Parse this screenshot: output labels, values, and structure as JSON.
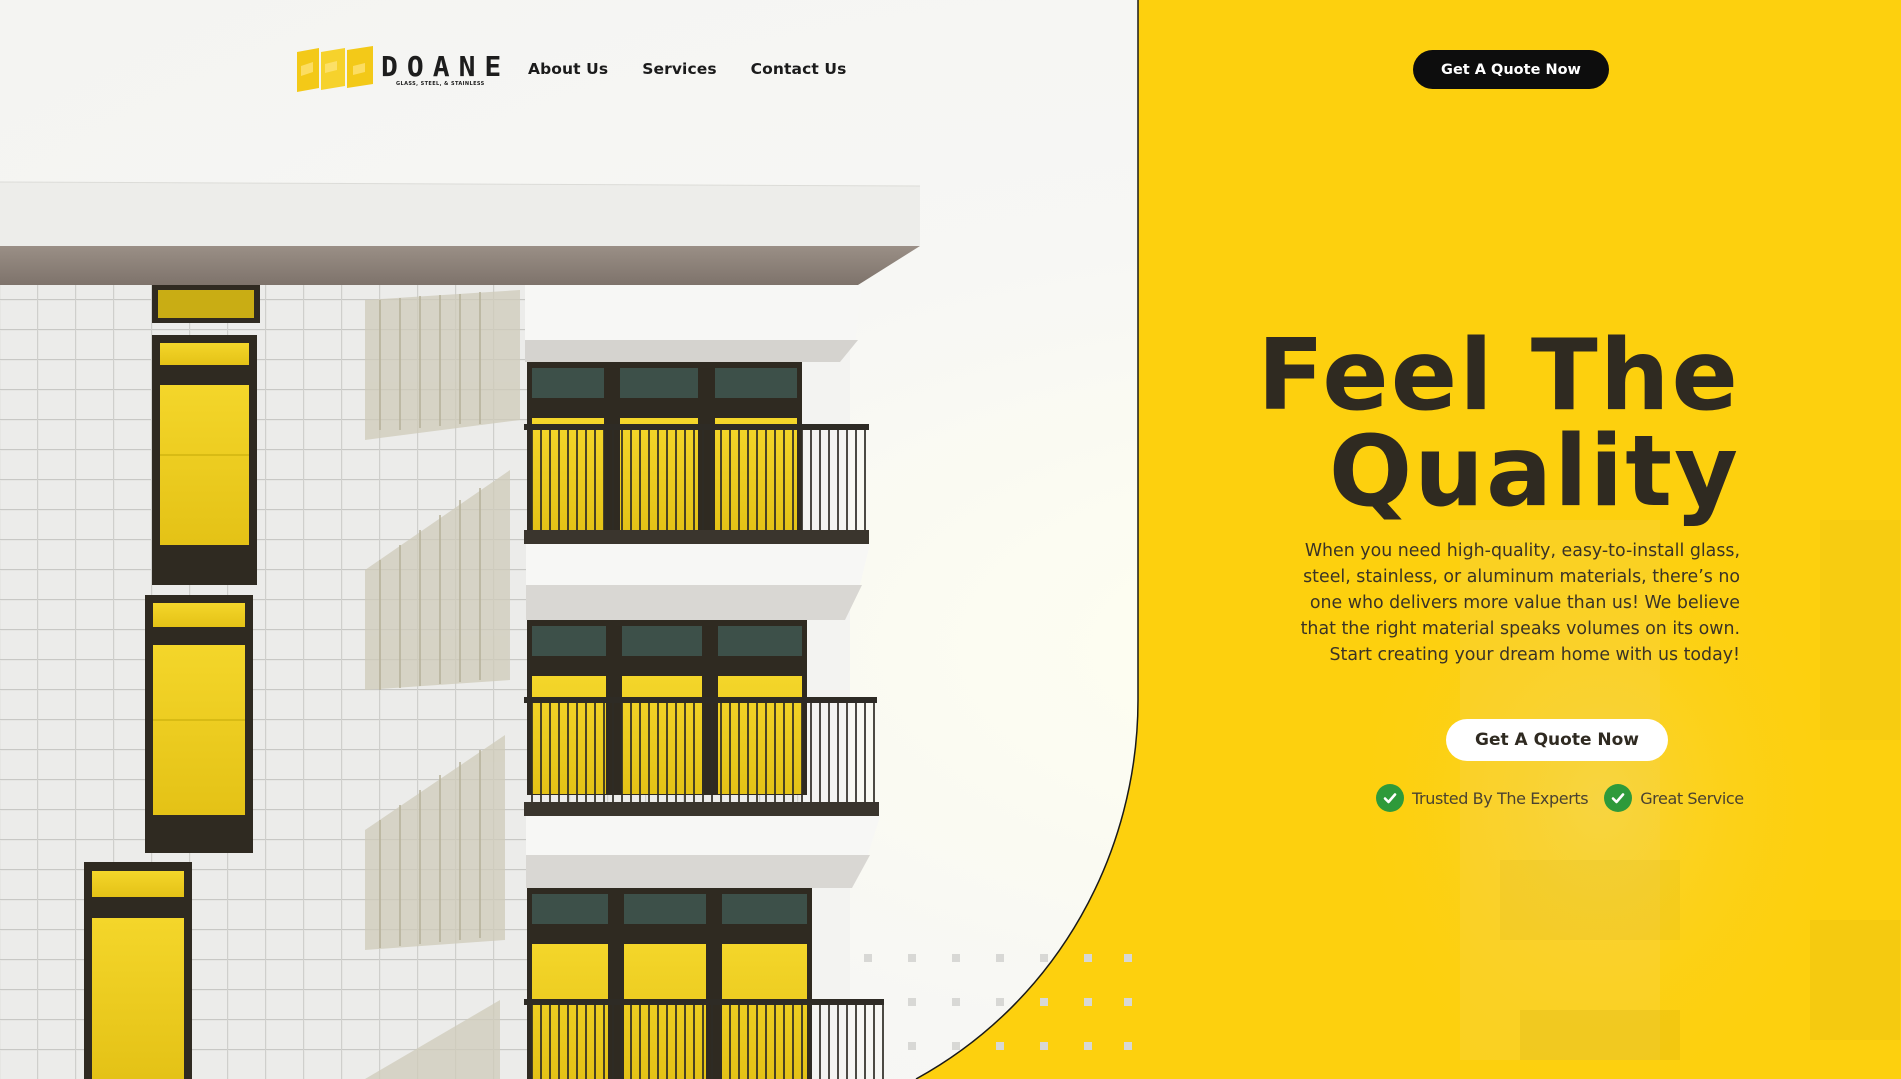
{
  "brand": {
    "name": "DOANE",
    "tagline": "GLASS, STEEL, & STAINLESS"
  },
  "nav": {
    "items": [
      {
        "label": "About Us"
      },
      {
        "label": "Services"
      },
      {
        "label": "Contact Us"
      }
    ]
  },
  "header": {
    "cta_label": "Get A Quote Now"
  },
  "hero": {
    "title_line1": "Feel The",
    "title_line2": "Quality",
    "description": "When you need high-quality, easy-to-install glass, steel, stainless, or aluminum materials, there’s no one who delivers more value than us! We believe that the right material speaks volumes on its own. Start creating your dream home with us today!",
    "cta_label": "Get A Quote Now",
    "badges": [
      {
        "label": "Trusted By The Experts",
        "icon": "check-circle-icon"
      },
      {
        "label": "Great Service",
        "icon": "check-circle-icon"
      }
    ]
  },
  "colors": {
    "yellow": "#fdd00e",
    "dark": "#2f2a21",
    "accent_yellow_window": "#f2d21c",
    "check_green": "#2e9a3a"
  }
}
